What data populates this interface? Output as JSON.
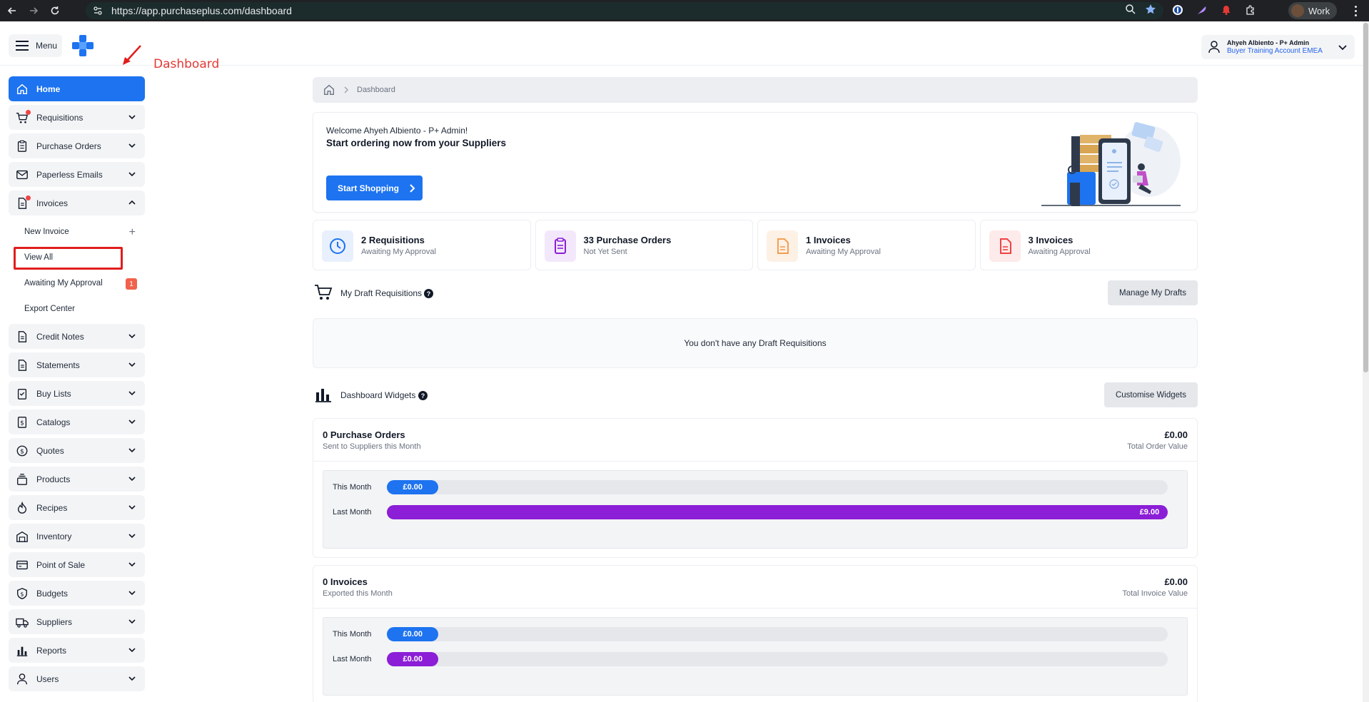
{
  "browser": {
    "url": "https://app.purchaseplus.com/dashboard",
    "profile_label": "Work"
  },
  "header": {
    "menu_label": "Menu",
    "account_name": "Ahyeh Albiento - P+ Admin",
    "account_org": "Buyer Training Account EMEA"
  },
  "annotation": {
    "label": "Dashboard"
  },
  "sidebar": {
    "items": [
      {
        "label": "Home",
        "icon": "home-icon"
      },
      {
        "label": "Requisitions",
        "icon": "cart-icon"
      },
      {
        "label": "Purchase Orders",
        "icon": "clipboard-icon"
      },
      {
        "label": "Paperless Emails",
        "icon": "mail-icon"
      },
      {
        "label": "Invoices",
        "icon": "document-icon"
      },
      {
        "label": "Credit Notes",
        "icon": "document-icon"
      },
      {
        "label": "Statements",
        "icon": "document-icon"
      },
      {
        "label": "Buy Lists",
        "icon": "checklist-icon"
      },
      {
        "label": "Catalogs",
        "icon": "dollar-doc-icon"
      },
      {
        "label": "Quotes",
        "icon": "dollar-circle-icon"
      },
      {
        "label": "Products",
        "icon": "products-icon"
      },
      {
        "label": "Recipes",
        "icon": "flame-icon"
      },
      {
        "label": "Inventory",
        "icon": "inventory-icon"
      },
      {
        "label": "Point of Sale",
        "icon": "pos-icon"
      },
      {
        "label": "Budgets",
        "icon": "budget-shield-icon"
      },
      {
        "label": "Suppliers",
        "icon": "truck-icon"
      },
      {
        "label": "Reports",
        "icon": "bar-chart-icon"
      },
      {
        "label": "Users",
        "icon": "user-icon"
      }
    ],
    "invoice_sub": {
      "new_invoice": "New Invoice",
      "view_all": "View All",
      "awaiting": "Awaiting My Approval",
      "awaiting_count": "1",
      "export": "Export Center"
    }
  },
  "breadcrumb": {
    "current": "Dashboard"
  },
  "welcome": {
    "greeting": "Welcome Ahyeh Albiento - P+ Admin!",
    "headline": "Start ordering now from your Suppliers",
    "button": "Start Shopping"
  },
  "stats": [
    {
      "title": "2 Requisitions",
      "subtitle": "Awaiting My Approval",
      "color": "#1d73f0"
    },
    {
      "title": "33 Purchase Orders",
      "subtitle": "Not Yet Sent",
      "color": "#8b1ed6"
    },
    {
      "title": "1 Invoices",
      "subtitle": "Awaiting My Approval",
      "color": "#f59e52"
    },
    {
      "title": "3 Invoices",
      "subtitle": "Awaiting Approval",
      "color": "#ef4444"
    }
  ],
  "drafts": {
    "title": "My Draft Requisitions",
    "button": "Manage My Drafts",
    "empty": "You don't have any Draft Requisitions"
  },
  "widgets_section": {
    "title": "Dashboard Widgets",
    "button": "Customise Widgets"
  },
  "widgets": [
    {
      "title": "0 Purchase Orders",
      "subtitle": "Sent to Suppliers this Month",
      "value": "£0.00",
      "value_label": "Total Order Value",
      "rows": [
        {
          "label": "This Month",
          "value": "£0.00",
          "fraction": 0.0
        },
        {
          "label": "Last Month",
          "value": "£9.00",
          "fraction": 1.0
        }
      ]
    },
    {
      "title": "0 Invoices",
      "subtitle": "Exported this Month",
      "value": "£0.00",
      "value_label": "Total Invoice Value",
      "rows": [
        {
          "label": "This Month",
          "value": "£0.00",
          "fraction": 0.0
        },
        {
          "label": "Last Month",
          "value": "£0.00",
          "fraction": 0.0
        }
      ]
    }
  ]
}
